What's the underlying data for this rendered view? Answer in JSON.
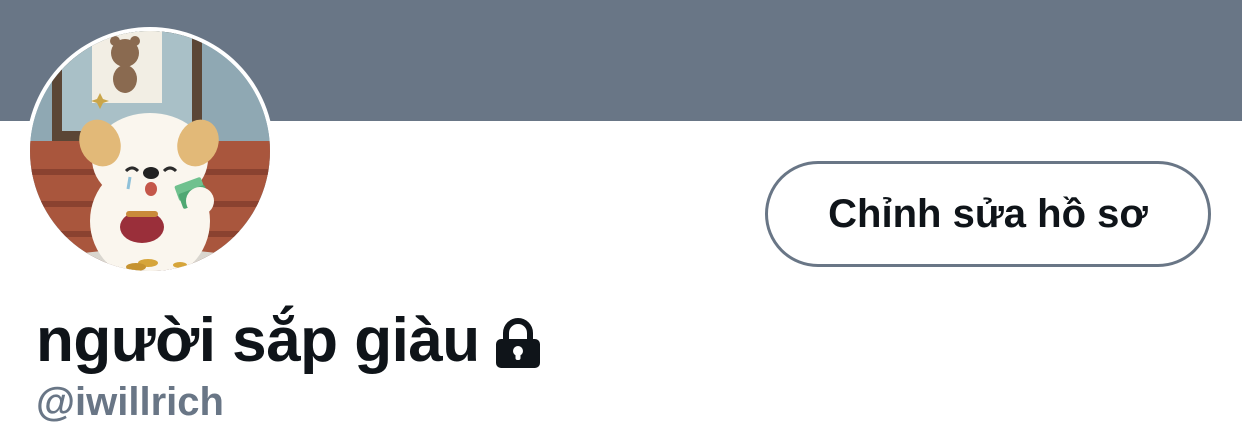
{
  "profile": {
    "display_name": "người sắp giàu",
    "handle": "@iwillrich",
    "edit_button_label": "Chỉnh sửa hồ sơ",
    "protected": true,
    "lock_icon": "lock-icon",
    "avatar_icon": "cartoon-puppy-avatar"
  },
  "colors": {
    "banner": "#697686",
    "button_border": "#697686",
    "text_primary": "#0f1419",
    "text_secondary": "#697686"
  }
}
